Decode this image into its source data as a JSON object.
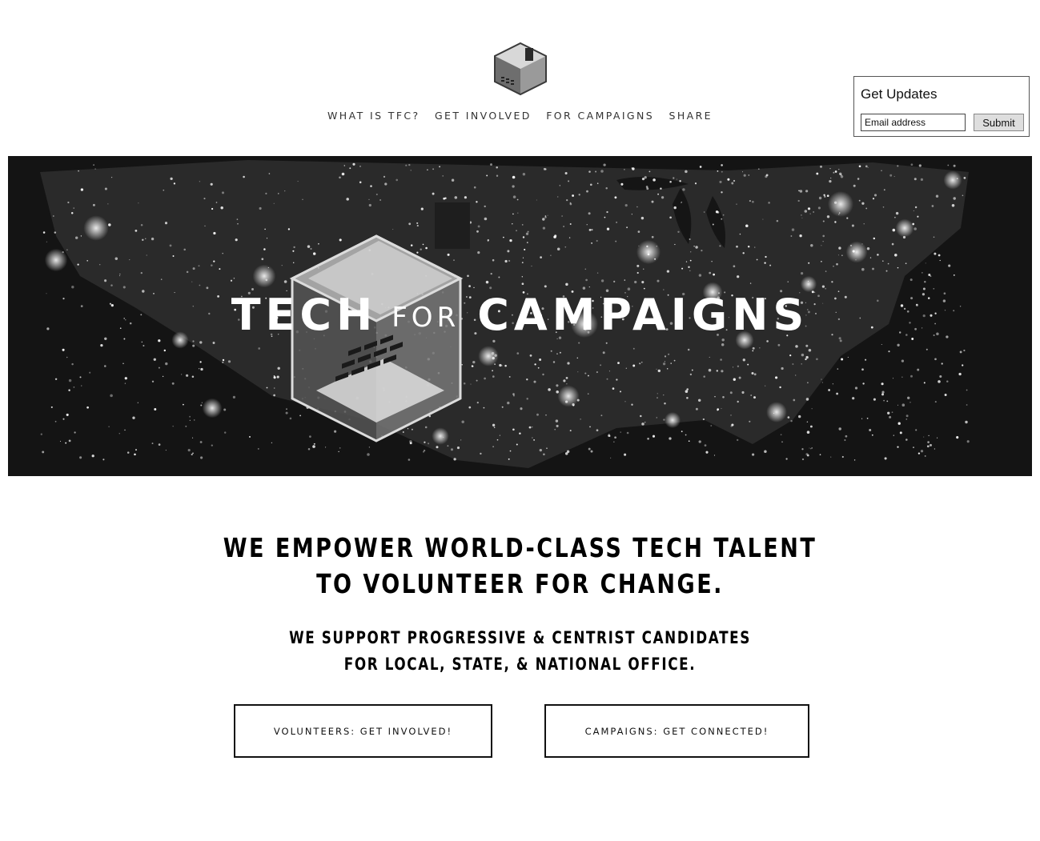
{
  "header": {
    "logo_icon": "ballot-box-cube-icon",
    "nav": [
      {
        "label": "WHAT IS TFC?"
      },
      {
        "label": "GET INVOLVED"
      },
      {
        "label": "FOR CAMPAIGNS"
      },
      {
        "label": "SHARE"
      }
    ]
  },
  "updates": {
    "title": "Get Updates",
    "email_placeholder": "Email address",
    "email_value": "",
    "submit_label": "Submit"
  },
  "hero": {
    "background": "night-lights-usa-map",
    "title_left": "TECH",
    "title_mid": "FOR",
    "title_right": "CAMPAIGNS"
  },
  "main": {
    "headline_line1": "WE EMPOWER WORLD-CLASS TECH TALENT",
    "headline_line2": "TO VOLUNTEER FOR CHANGE.",
    "subhead_line1": "WE SUPPORT PROGRESSIVE & CENTRIST CANDIDATES",
    "subhead_line2": "FOR LOCAL, STATE, & NATIONAL OFFICE.",
    "volunteer_button": "VOLUNTEERS: GET INVOLVED!",
    "campaign_button": "CAMPAIGNS: GET CONNECTED!"
  },
  "colors": {
    "hero_bg": "#141414",
    "text": "#000000",
    "nav_text": "#333333"
  }
}
